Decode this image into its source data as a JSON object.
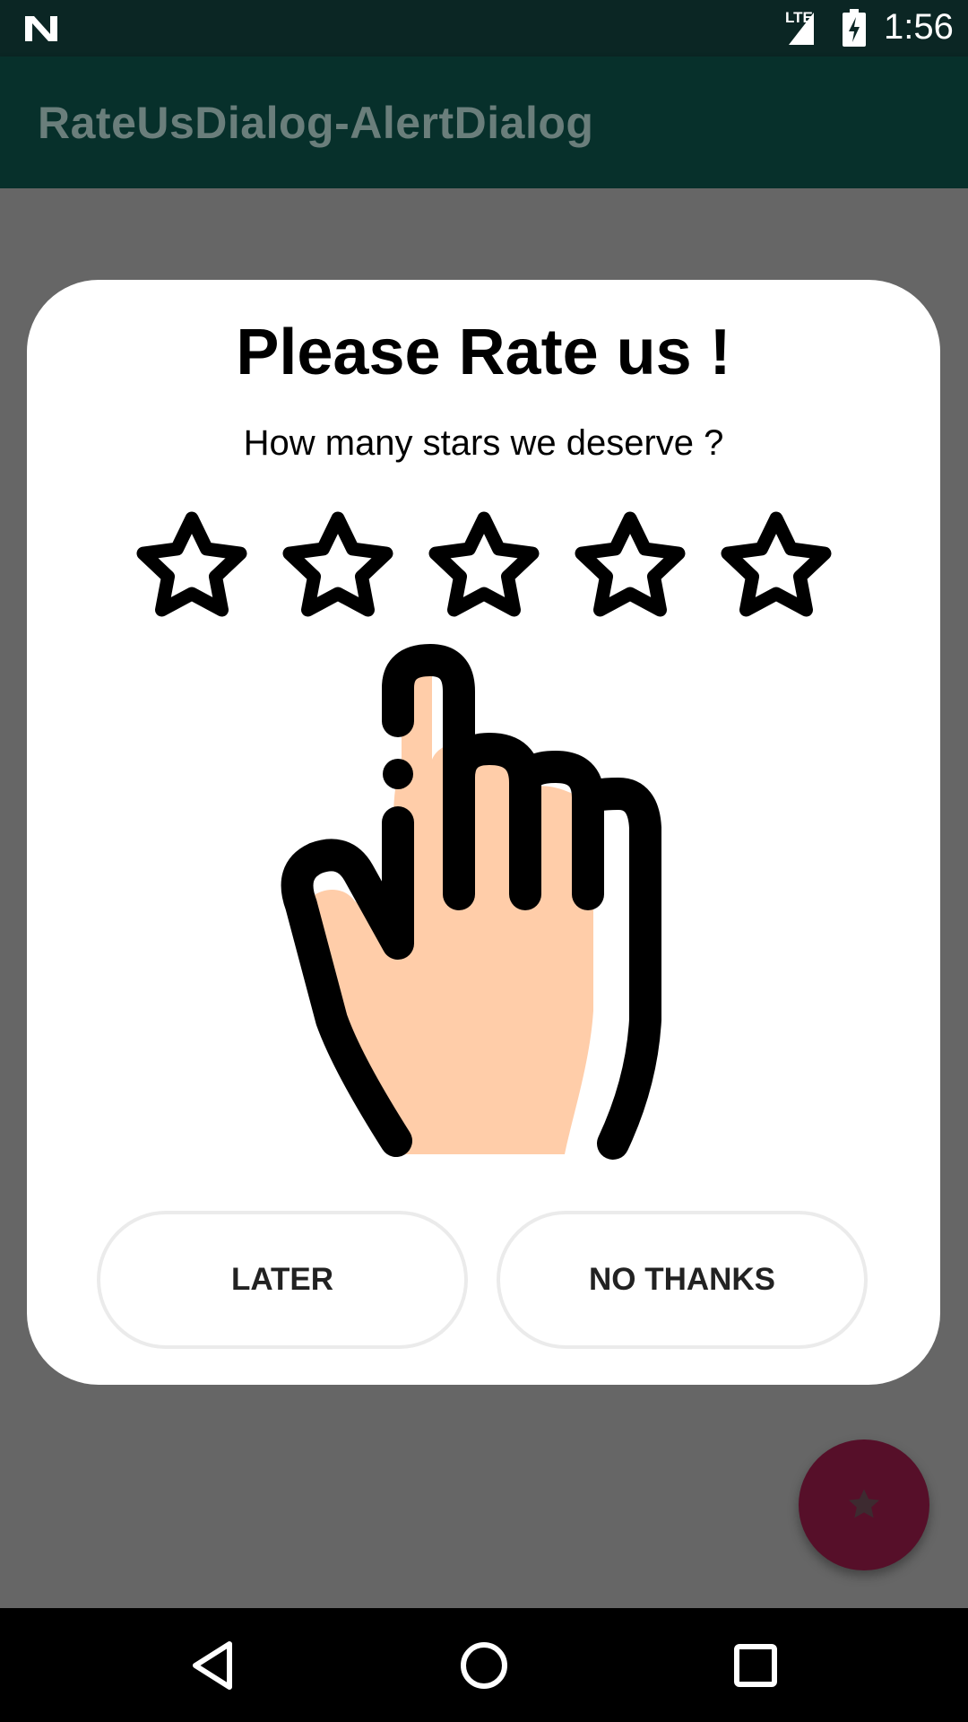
{
  "status_bar": {
    "time": "1:56",
    "network": "LTE",
    "icons": [
      "notification-n-icon",
      "signal-icon",
      "battery-charging-icon"
    ]
  },
  "app_bar": {
    "title": "RateUsDialog-AlertDialog"
  },
  "dialog": {
    "title": "Please Rate us !",
    "subtitle": "How many stars we deserve ?",
    "stars": {
      "total": 5,
      "selected": 0
    },
    "illustration": "pointing-hand-icon",
    "buttons": {
      "later": "LATER",
      "no_thanks": "NO THANKS"
    }
  },
  "fab": {
    "icon": "star-icon"
  },
  "nav_bar": {
    "icons": [
      "back-icon",
      "home-icon",
      "recents-icon"
    ]
  },
  "colors": {
    "status_bar": "#0b2624",
    "app_bar": "#07302b",
    "scrim": "#666666",
    "fab": "#560f29",
    "hand_skin": "#ffcda9"
  }
}
